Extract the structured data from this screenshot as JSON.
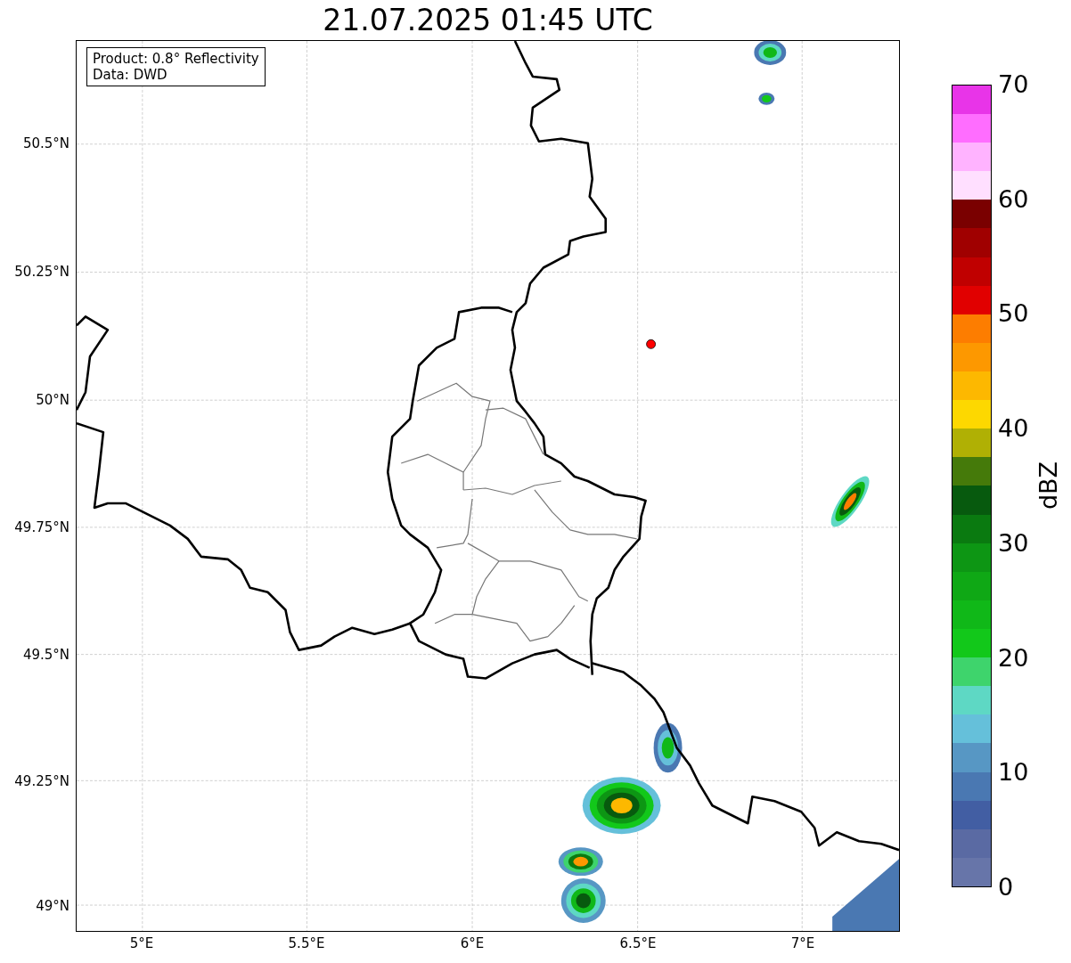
{
  "title": "21.07.2025 01:45 UTC",
  "info_box": [
    "Product: 0.8° Reflectivity",
    "Data: DWD"
  ],
  "map": {
    "y_ticks": [
      "50.5°N",
      "50.25°N",
      "50°N",
      "49.75°N",
      "49.5°N",
      "49.25°N",
      "49°N"
    ],
    "x_ticks": [
      "5°E",
      "5.5°E",
      "6°E",
      "6.5°E",
      "7°E"
    ]
  },
  "colorbar": {
    "label": "dBZ",
    "ticks": [
      "70",
      "60",
      "50",
      "40",
      "30",
      "20",
      "10",
      "0"
    ],
    "bins": [
      {
        "color": "#6775a9"
      },
      {
        "color": "#5a6aa3"
      },
      {
        "color": "#425ea3"
      },
      {
        "color": "#4a78b2"
      },
      {
        "color": "#5797c4"
      },
      {
        "color": "#65c0da"
      },
      {
        "color": "#5ed8c4"
      },
      {
        "color": "#3ed46c"
      },
      {
        "color": "#12c81a"
      },
      {
        "color": "#10b818"
      },
      {
        "color": "#0fa815"
      },
      {
        "color": "#0d9614"
      },
      {
        "color": "#0a7a10"
      },
      {
        "color": "#075a0e"
      },
      {
        "color": "#457a0a"
      },
      {
        "color": "#b0b004"
      },
      {
        "color": "#fdd800"
      },
      {
        "color": "#fdb800"
      },
      {
        "color": "#fd9800"
      },
      {
        "color": "#fd7d00"
      },
      {
        "color": "#e10000"
      },
      {
        "color": "#c00000"
      },
      {
        "color": "#a00000"
      },
      {
        "color": "#7a0000"
      },
      {
        "color": "#ffdfff"
      },
      {
        "color": "#ffb3ff"
      },
      {
        "color": "#ff6dff"
      },
      {
        "color": "#e834e8"
      }
    ]
  }
}
